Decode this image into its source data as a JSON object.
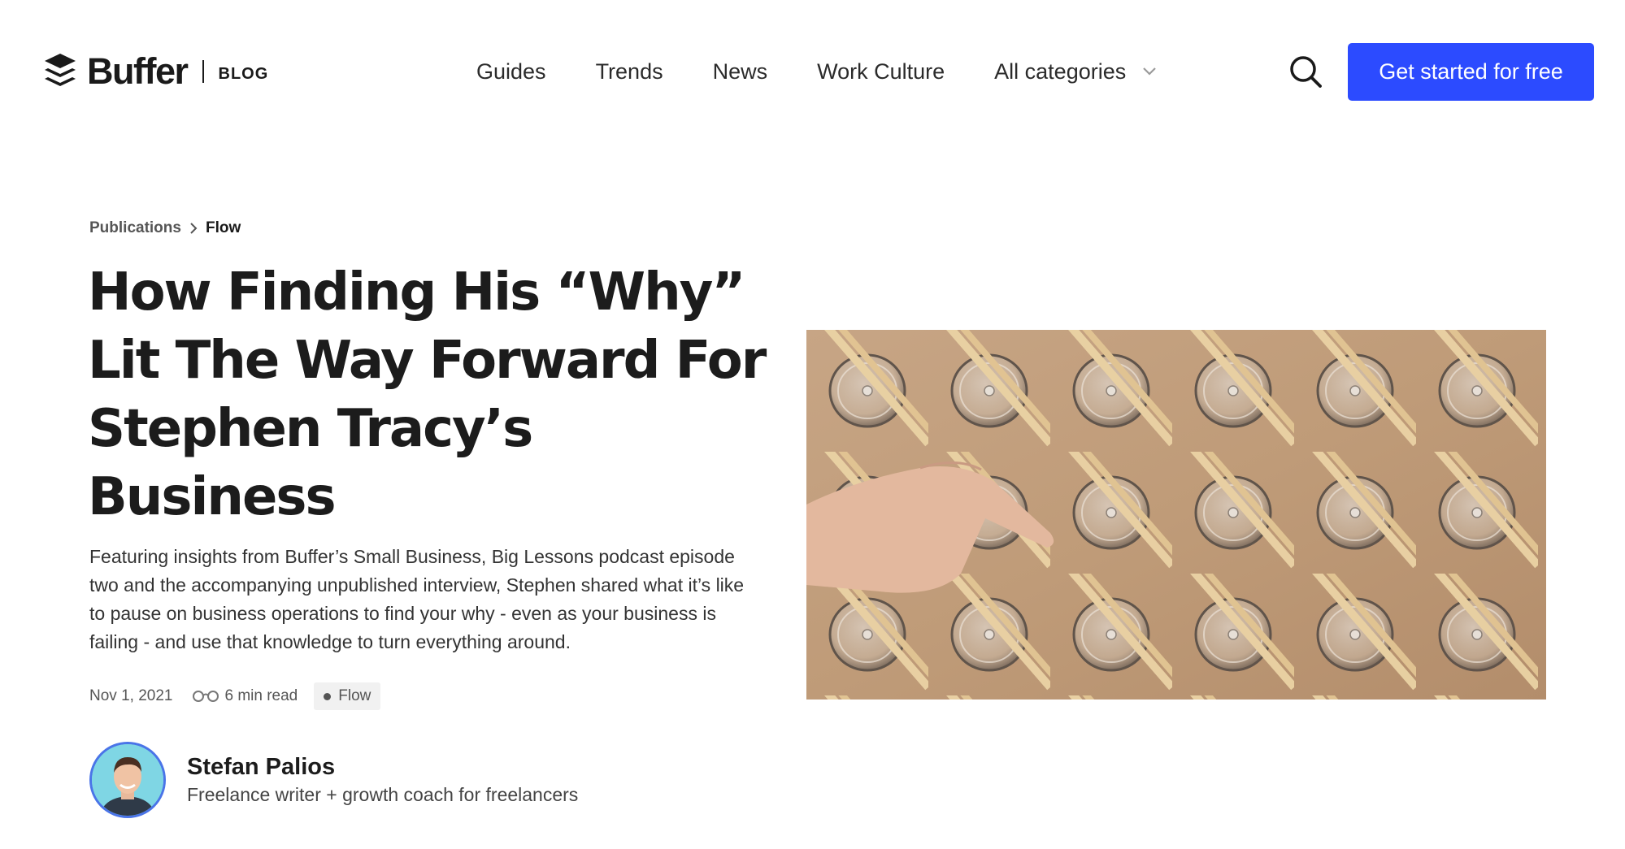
{
  "header": {
    "logo_text": "Buffer",
    "logo_section": "BLOG",
    "nav": [
      {
        "label": "Guides"
      },
      {
        "label": "Trends"
      },
      {
        "label": "News"
      },
      {
        "label": "Work Culture"
      },
      {
        "label": "All categories",
        "icon": "chevron-down-icon"
      }
    ],
    "search_icon": "search-icon",
    "cta_label": "Get started for free"
  },
  "article": {
    "breadcrumb": [
      "Publications",
      "Flow"
    ],
    "title": "How Finding His “Why” Lit The Way Forward For Stephen Tracy’s Business",
    "description": "Featuring insights from Buffer’s Small Business, Big Lessons podcast episode two and the accompanying unpublished interview, Stephen shared what it’s like to pause on business operations to find your why - even as your business is failing - and use that knowledge to turn everything around.",
    "date": "Nov 1, 2021",
    "read_time": "6 min read",
    "read_icon": "glasses-icon",
    "tag": "Flow",
    "author": {
      "name": "Stefan Palios",
      "bio": "Freelance writer + growth coach for freelancers"
    }
  },
  "colors": {
    "accent": "#2c4bff",
    "text": "#1c1c1c",
    "avatar_ring": "#4a74e8",
    "avatar_bg": "#7fd6e4",
    "tag_bg": "#f1f1f1"
  }
}
